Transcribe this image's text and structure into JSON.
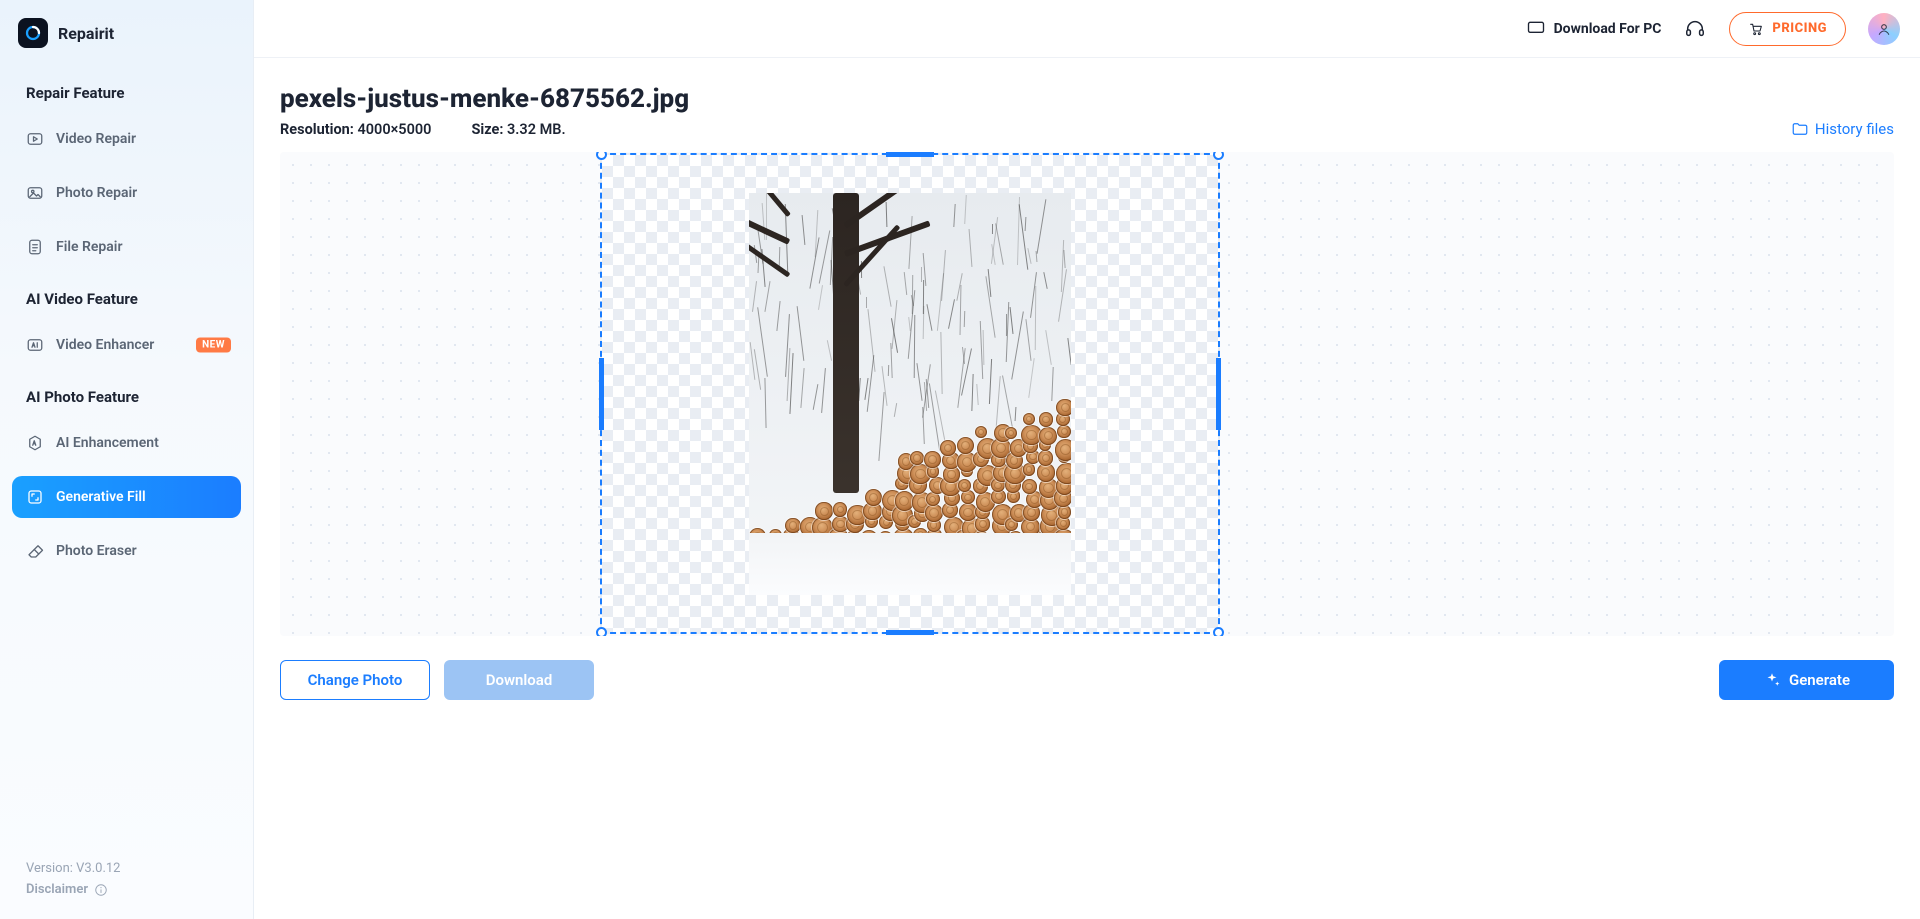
{
  "app": {
    "name": "Repairit",
    "version": "Version: V3.0.12",
    "disclaimer": "Disclaimer"
  },
  "topbar": {
    "download": "Download For PC",
    "pricing": "PRICING"
  },
  "sidebar": {
    "sections": [
      {
        "title": "Repair Feature",
        "items": [
          {
            "id": "video-repair",
            "label": "Video Repair"
          },
          {
            "id": "photo-repair",
            "label": "Photo Repair"
          },
          {
            "id": "file-repair",
            "label": "File Repair"
          }
        ]
      },
      {
        "title": "AI Video Feature",
        "items": [
          {
            "id": "video-enhancer",
            "label": "Video Enhancer",
            "badge": "NEW"
          }
        ]
      },
      {
        "title": "AI Photo Feature",
        "items": [
          {
            "id": "ai-enhancement",
            "label": "AI Enhancement"
          },
          {
            "id": "generative-fill",
            "label": "Generative Fill",
            "active": true
          },
          {
            "id": "photo-eraser",
            "label": "Photo Eraser"
          }
        ]
      }
    ]
  },
  "file": {
    "name": "pexels-justus-menke-6875562.jpg",
    "resolution_label": "Resolution: ",
    "resolution_value": "4000×5000",
    "size_label": "Size: ",
    "size_value": "3.32 MB."
  },
  "links": {
    "history": "History files"
  },
  "actions": {
    "change": "Change Photo",
    "download": "Download",
    "generate": "Generate"
  }
}
